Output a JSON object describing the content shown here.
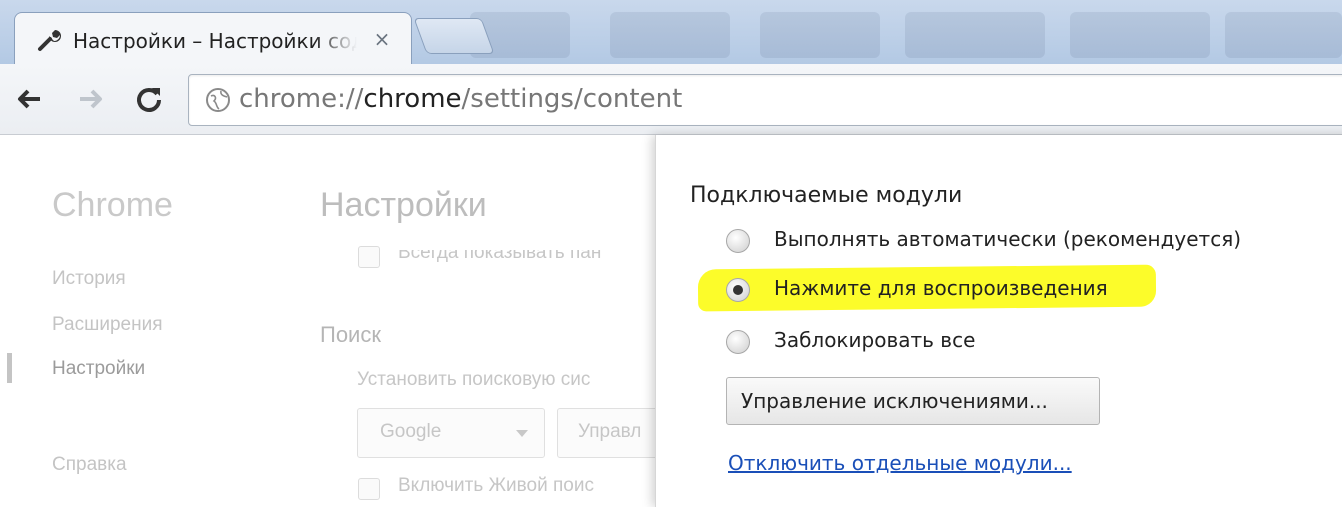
{
  "tab": {
    "title": "Настройки – Настройки содержимого",
    "close_glyph": "×",
    "icon": "wrench-icon"
  },
  "toolbar": {
    "url_prefix": "chrome://",
    "url_host": "chrome",
    "url_path": "/settings/content",
    "icons": [
      "back-arrow-icon",
      "forward-arrow-icon",
      "reload-icon",
      "globe-icon"
    ]
  },
  "background_page": {
    "nav_title": "Chrome",
    "nav_items": [
      "История",
      "Расширения",
      "Настройки",
      "Справка"
    ],
    "nav_selected": "Настройки",
    "main_title": "Настройки",
    "partial_checkbox_text": "Всегда показывать пан",
    "search_section_title": "Поиск",
    "search_description": "Установить поисковую сис",
    "search_engine_select": "Google",
    "manage_button_partial": "Управл",
    "instant_checkbox_text": "Включить Живой поис"
  },
  "dialog": {
    "heading": "Подключаемые модули",
    "options": [
      {
        "label": "Выполнять автоматически (рекомендуется)",
        "checked": false
      },
      {
        "label": "Нажмите для воспроизведения",
        "checked": true,
        "highlighted": true
      },
      {
        "label": "Заблокировать все",
        "checked": false
      }
    ],
    "manage_exceptions_button": "Управление исключениями...",
    "disable_link": "Отключить отдельные модули..."
  },
  "colors": {
    "highlight": "#fcfc2a",
    "link": "#1a4fb8",
    "tabstrip": "#b3c9e4"
  }
}
